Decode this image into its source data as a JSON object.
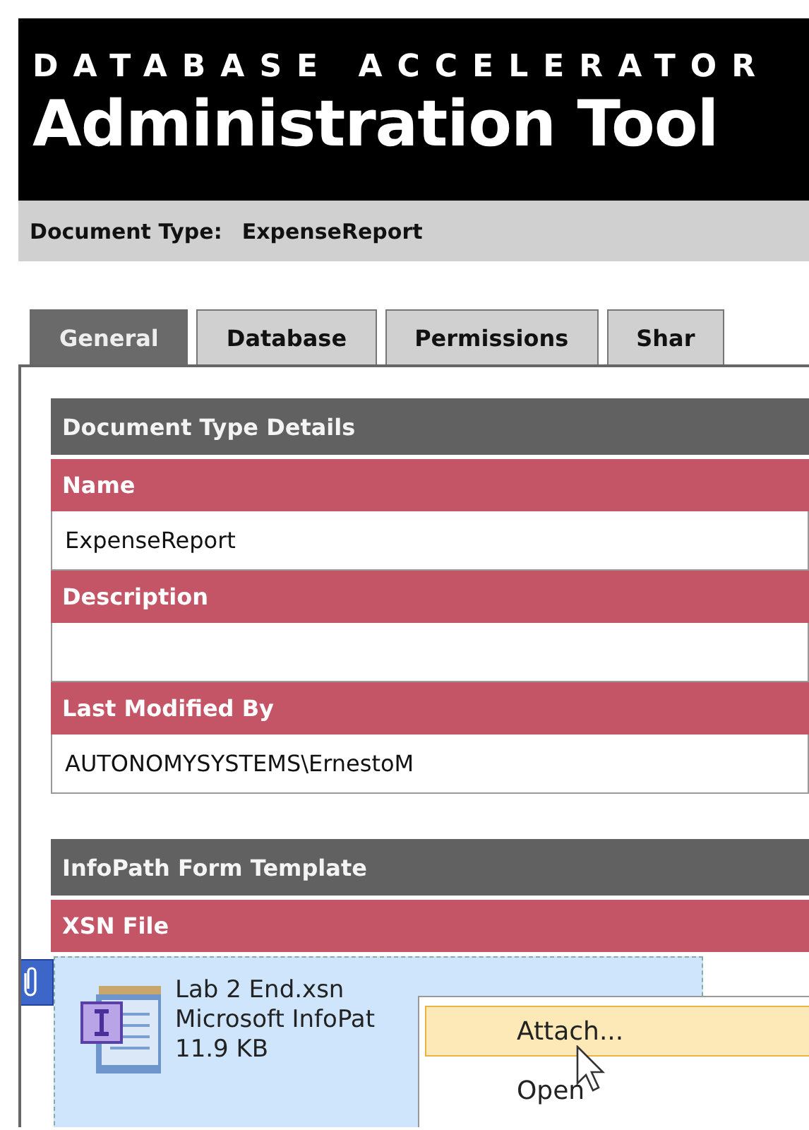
{
  "header": {
    "subtitle": "DATABASE ACCELERATOR",
    "title": "Administration Tool"
  },
  "document_type": {
    "label": "Document Type:",
    "value": "ExpenseReport"
  },
  "tabs": [
    {
      "label": "General",
      "selected": true
    },
    {
      "label": "Database",
      "selected": false
    },
    {
      "label": "Permissions",
      "selected": false
    },
    {
      "label": "Shar",
      "selected": false
    }
  ],
  "sections": [
    {
      "title": "Document Type Details",
      "fields": [
        {
          "label": "Name",
          "value": "ExpenseReport"
        },
        {
          "label": "Description"
        },
        {
          "label": "Last Modified By",
          "value": "AUTONOMYSYSTEMS\\ErnestoM"
        }
      ]
    },
    {
      "title": "InfoPath Form Template",
      "fields": [
        {
          "label": "XSN File",
          "kind": "attachment",
          "file": {
            "name": "Lab 2 End.xsn",
            "type": "Microsoft InfoPat",
            "size": "11.9 KB"
          }
        }
      ]
    }
  ],
  "context_menu": [
    {
      "label": "Attach...",
      "selected": true
    },
    {
      "label": "Open",
      "selected": false
    }
  ]
}
